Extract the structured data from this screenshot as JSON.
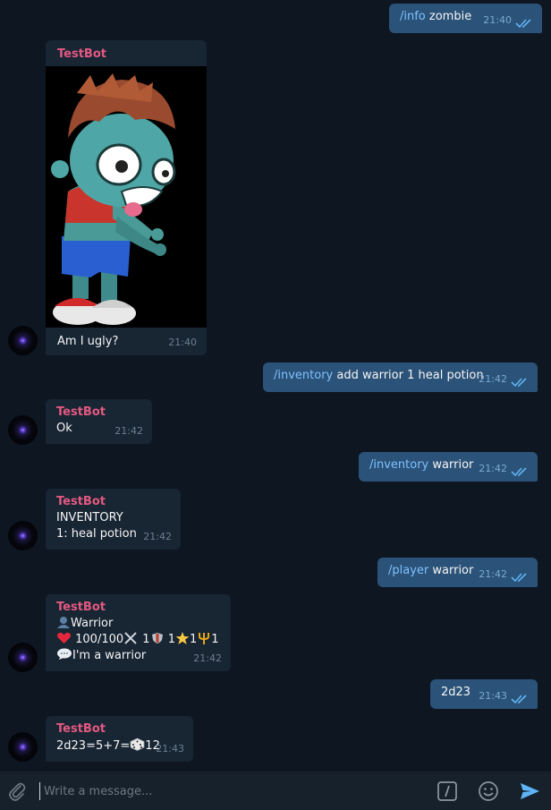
{
  "messages": {
    "m1": {
      "cmd": "/info",
      "text": " zombie",
      "time": "21:40"
    },
    "m2": {
      "sender": "TestBot",
      "caption": "Am I ugly?",
      "time": "21:40"
    },
    "m3": {
      "cmd": "/inventory",
      "text": " add warrior 1 heal potion",
      "time": "21:42"
    },
    "m4": {
      "sender": "TestBot",
      "text": "Ok",
      "time": "21:42"
    },
    "m5": {
      "cmd": "/inventory",
      "text": " warrior",
      "time": "21:42"
    },
    "m6": {
      "sender": "TestBot",
      "line1": "INVENTORY",
      "line2": "1:  heal potion",
      "time": "21:42"
    },
    "m7": {
      "cmd": "/player",
      "text": " warrior",
      "time": "21:42"
    },
    "m8": {
      "sender": "TestBot",
      "line1": "Warrior",
      "hp": "100/100",
      "atk": "1",
      "def": "1",
      "star": "1",
      "trident": "1",
      "line3": "I'm a warrior",
      "time": "21:42"
    },
    "m9": {
      "text": "2d23",
      "time": "21:43"
    },
    "m10": {
      "sender": "TestBot",
      "text_pre": "2d23=5+7=",
      "text_post": "12",
      "time": "21:43"
    }
  },
  "composer": {
    "placeholder": "Write a message..."
  },
  "icons": {
    "attach": "paperclip-icon",
    "commands": "slash-command-icon",
    "emoji": "smiley-icon",
    "send": "send-arrow-icon"
  },
  "colors": {
    "background": "#0e1621",
    "outgoing_bubble": "#2b5278",
    "incoming_bubble": "#182533",
    "sender_name": "#e45981",
    "command_link": "#7fc1ff",
    "send_button": "#5eb5f7"
  }
}
